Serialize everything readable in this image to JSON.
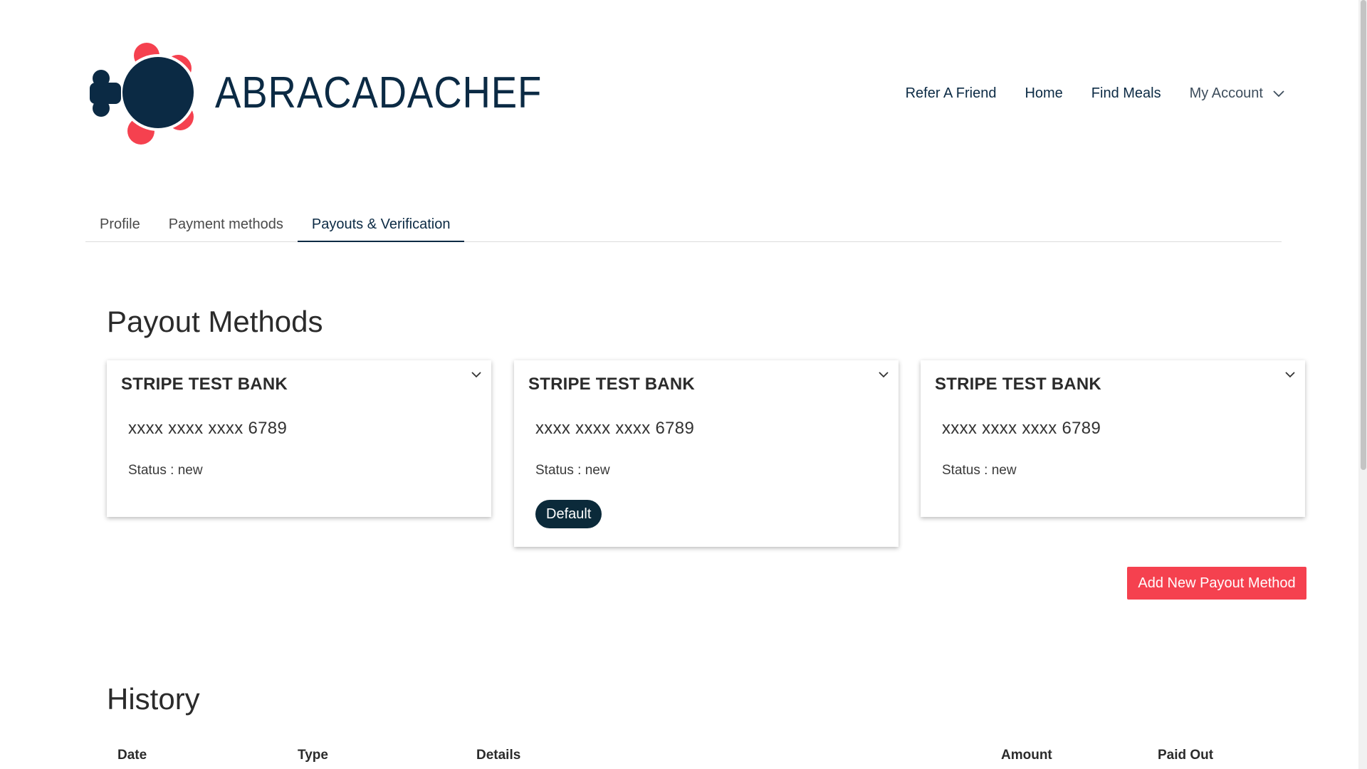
{
  "brand": {
    "name": "ABRACADACHEF",
    "accent": "#f5414f",
    "primary": "#0b2a44"
  },
  "nav": {
    "items": [
      {
        "label": "Refer A Friend"
      },
      {
        "label": "Home"
      },
      {
        "label": "Find Meals"
      }
    ],
    "account": {
      "label": "My Account",
      "icon": "chevron-down-icon"
    }
  },
  "tabs": [
    {
      "label": "Profile",
      "active": false
    },
    {
      "label": "Payment methods",
      "active": false
    },
    {
      "label": "Payouts & Verification",
      "active": true
    }
  ],
  "payout_methods": {
    "title": "Payout Methods",
    "cards": [
      {
        "bank": "STRIPE TEST BANK",
        "account": "xxxx xxxx xxxx 6789",
        "status": "Status : new",
        "default": false
      },
      {
        "bank": "STRIPE TEST BANK",
        "account": "xxxx xxxx xxxx 6789",
        "status": "Status : new",
        "default": true,
        "badge": "Default"
      },
      {
        "bank": "STRIPE TEST BANK",
        "account": "xxxx xxxx xxxx 6789",
        "status": "Status : new",
        "default": false
      }
    ],
    "add_button": "Add New Payout Method"
  },
  "history": {
    "title": "History",
    "columns": [
      "Date",
      "Type",
      "Details",
      "Amount",
      "Paid Out"
    ]
  }
}
